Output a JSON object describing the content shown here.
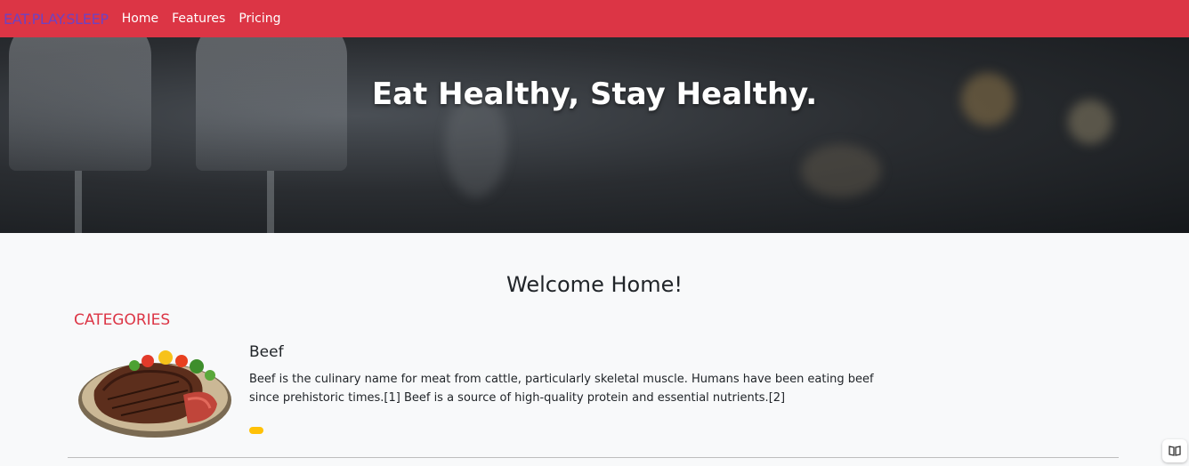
{
  "navbar": {
    "brand": "EAT.PLAY.SLEEP",
    "links": [
      "Home",
      "Features",
      "Pricing"
    ]
  },
  "hero": {
    "title": "Eat Healthy, Stay Healthy."
  },
  "main": {
    "welcome": "Welcome Home!",
    "categories_label": "CATEGORIES",
    "items": [
      {
        "title": "Beef",
        "description": "Beef is the culinary name for meat from cattle, particularly skeletal muscle. Humans have been eating beef since prehistoric times.[1] Beef is a source of high-quality protein and essential nutrients.[2]"
      }
    ]
  },
  "reader_icon": "book-reader-icon",
  "colors": {
    "navbar": "#dc3545",
    "brand": "#6f42c1",
    "accent_button": "#ffc107",
    "background": "#f8f9fa"
  }
}
